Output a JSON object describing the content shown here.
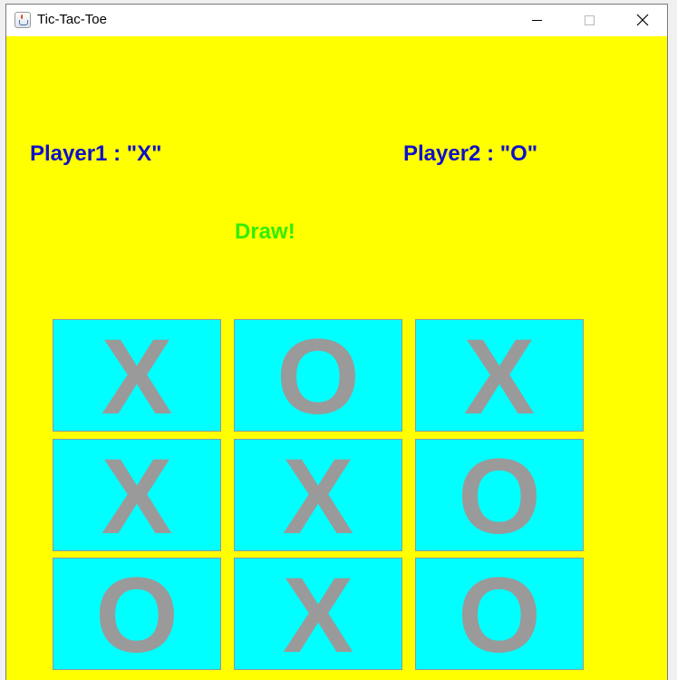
{
  "window": {
    "title": "Tic-Tac-Toe",
    "icon": "java-cup-icon"
  },
  "labels": {
    "player1": "Player1 : \"X\"",
    "player2": "Player2 : \"O\"",
    "status": "Draw!"
  },
  "board": [
    [
      "X",
      "O",
      "X"
    ],
    [
      "X",
      "X",
      "O"
    ],
    [
      "O",
      "X",
      "O"
    ]
  ],
  "colors": {
    "background": "#ffff00",
    "cell": "#00ffff",
    "mark": "#9a9a9a",
    "player_text": "#1010c8",
    "status_text": "#33ee00"
  }
}
